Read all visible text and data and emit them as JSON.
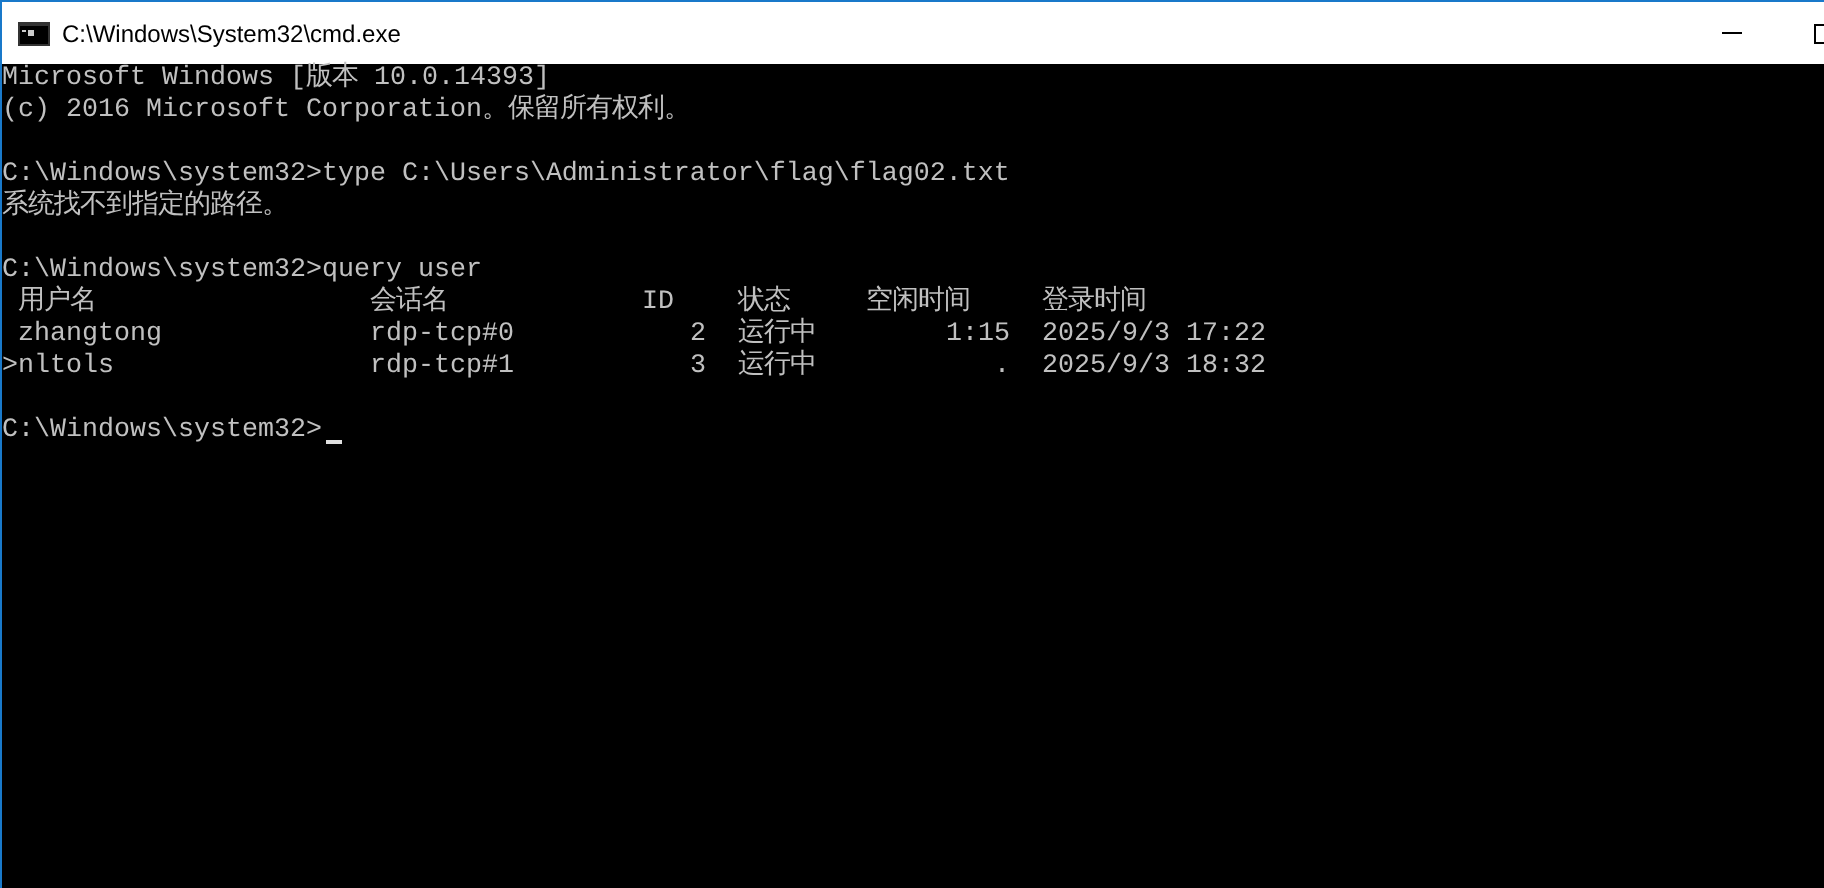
{
  "window": {
    "title": "C:\\Windows\\System32\\cmd.exe"
  },
  "console": {
    "blocks": [
      [
        "Microsoft Windows [版本 10.0.14393]",
        "(c) 2016 Microsoft Corporation。保留所有权利。"
      ],
      [
        "C:\\Windows\\system32>type C:\\Users\\Administrator\\flag\\flag02.txt",
        "系统找不到指定的路径。"
      ],
      [
        "C:\\Windows\\system32>query user"
      ]
    ],
    "table": {
      "columns": [
        " 用户名",
        "会话名",
        "ID",
        "状态",
        "空闲时间",
        "登录时间"
      ],
      "rows": [
        [
          " zhangtong",
          "rdp-tcp#0",
          "2",
          "运行中",
          "1:15",
          "2025/9/3 17:22"
        ],
        [
          ">nltols",
          "rdp-tcp#1",
          "3",
          "运行中",
          ".",
          "2025/9/3 18:32"
        ]
      ]
    },
    "prompt": "C:\\Windows\\system32>"
  }
}
